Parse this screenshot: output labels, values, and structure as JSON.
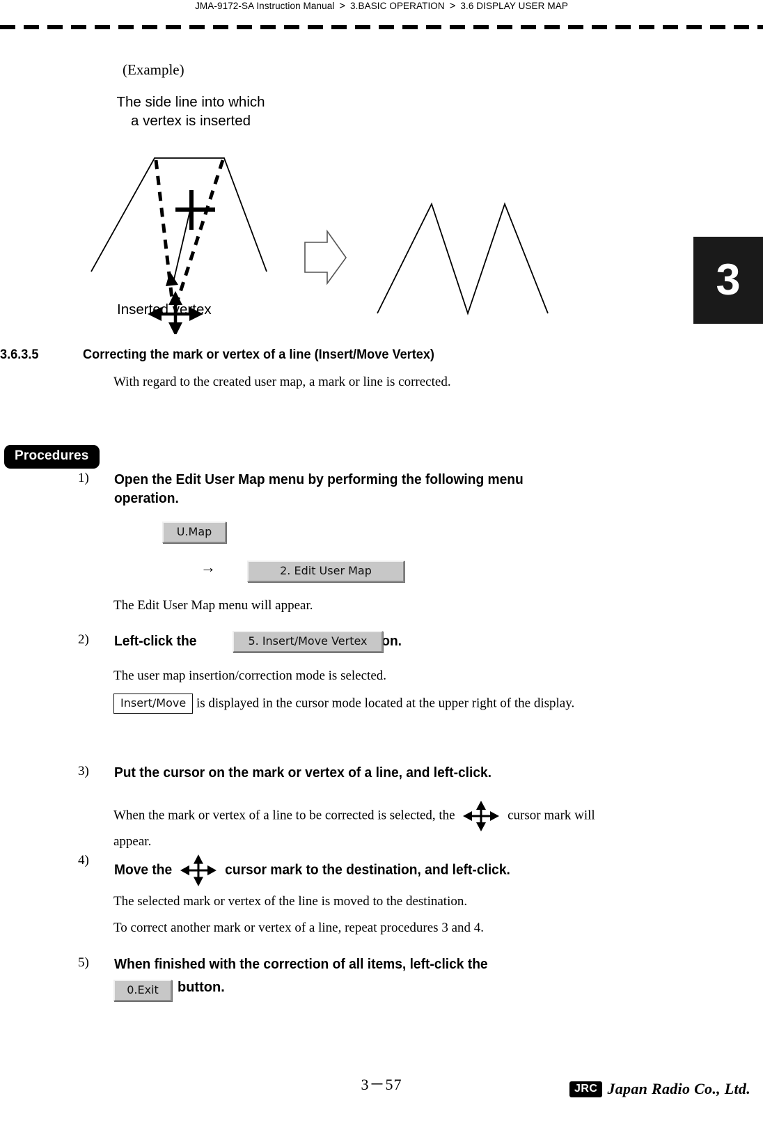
{
  "header": {
    "manual": "JMA-9172-SA Instruction Manual",
    "sep1": ">",
    "chapter": "3.BASIC OPERATION",
    "sep2": ">",
    "section": "3.6  DISPLAY USER MAP"
  },
  "chapter_tab": {
    "number": "3"
  },
  "figure": {
    "example_label": "(Example)",
    "side_line_label": "The side line into which\na vertex is inserted",
    "inserted_vertex_label": "Inserted vertex"
  },
  "section": {
    "number": "3.6.3.5",
    "title": "Correcting the mark or vertex of a line (Insert/Move Vertex)",
    "description": "With regard to the created user map, a mark or line is corrected."
  },
  "procedures": {
    "badge": "Procedures",
    "steps": [
      {
        "number": "1)",
        "title_line1": "Open the Edit User Map menu by performing the following menu",
        "title_line2": "operation.",
        "menu_button_1": "U.Map",
        "arrow": "→",
        "menu_button_2": "2. Edit User Map",
        "result": "The Edit User Map menu will appear."
      },
      {
        "number": "2)",
        "title_before": "Left-click the",
        "button": "5. Insert/Move Vertex",
        "title_after": "button.",
        "result1": "The user map insertion/correction mode is selected.",
        "result2_button": "Insert/Move",
        "result2_text": "is displayed in the cursor mode located at the upper right of the display."
      },
      {
        "number": "3)",
        "title": "Put the cursor on the mark or vertex of a line, and left-click.",
        "result_before": "When the mark or vertex of a line to be corrected is selected, the",
        "result_icon": "four-way-cursor-icon",
        "result_after": "cursor mark will",
        "result_line2": "appear."
      },
      {
        "number": "4)",
        "title_before": "Move the",
        "title_icon": "four-way-cursor-icon",
        "title_after": "cursor mark to the destination, and left-click.",
        "result1": "The selected mark or vertex of the line is moved to the destination.",
        "result2": "To correct another mark or vertex of a line, repeat procedures 3 and 4."
      },
      {
        "number": "5)",
        "title_line1": "When finished with the correction of all items, left-click the",
        "button": "0.Exit",
        "title_after": "button."
      }
    ]
  },
  "footer": {
    "page": "3－57",
    "logo_mark": "JRC",
    "logo_name": "Japan Radio Co., Ltd."
  }
}
